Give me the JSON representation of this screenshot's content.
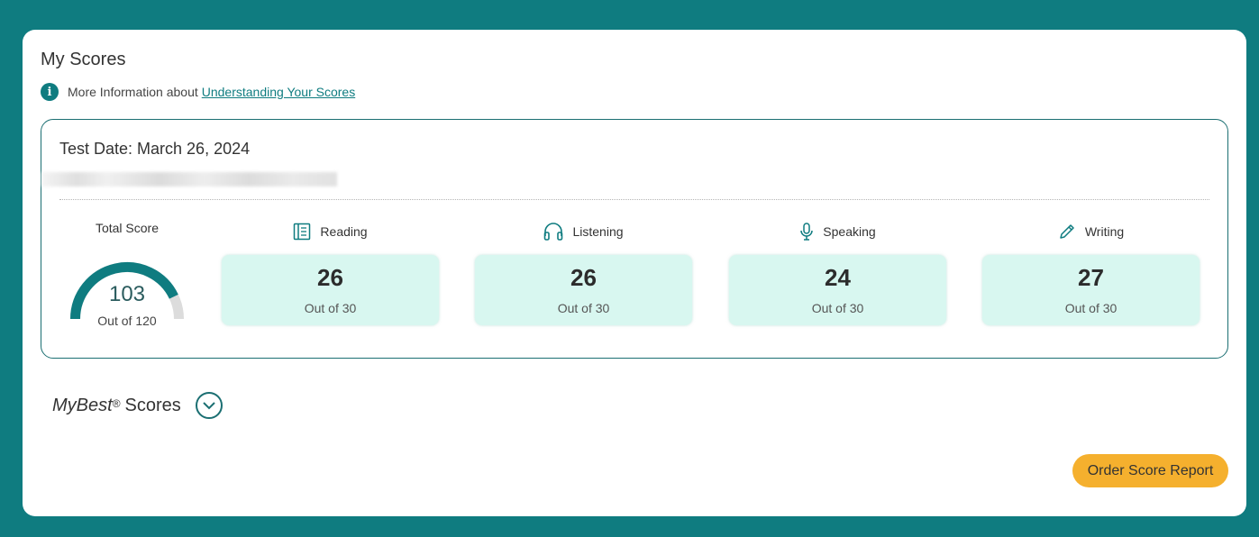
{
  "page": {
    "title": "My Scores",
    "info_prefix": "More Information about",
    "info_link": "Understanding Your Scores",
    "info_icon": "info-icon"
  },
  "test": {
    "date": "Test Date: March 26, 2024",
    "total": {
      "label": "Total Score",
      "value": "103",
      "out_of": "Out of 120",
      "score_fraction": 0.858
    },
    "sections": [
      {
        "name": "Reading",
        "icon": "book-icon",
        "score": "26",
        "out_of": "Out of 30"
      },
      {
        "name": "Listening",
        "icon": "headphones-icon",
        "score": "26",
        "out_of": "Out of 30"
      },
      {
        "name": "Speaking",
        "icon": "microphone-icon",
        "score": "24",
        "out_of": "Out of 30"
      },
      {
        "name": "Writing",
        "icon": "pencil-icon",
        "score": "27",
        "out_of": "Out of 30"
      }
    ]
  },
  "mybest": {
    "label_italic": "MyBest",
    "registered": "®",
    "label_rest": "Scores"
  },
  "actions": {
    "order_report": "Order Score Report"
  },
  "colors": {
    "background": "#0f7c80",
    "accent": "#0f7c80",
    "tile": "#d8f7f0",
    "button": "#f5b02e"
  }
}
